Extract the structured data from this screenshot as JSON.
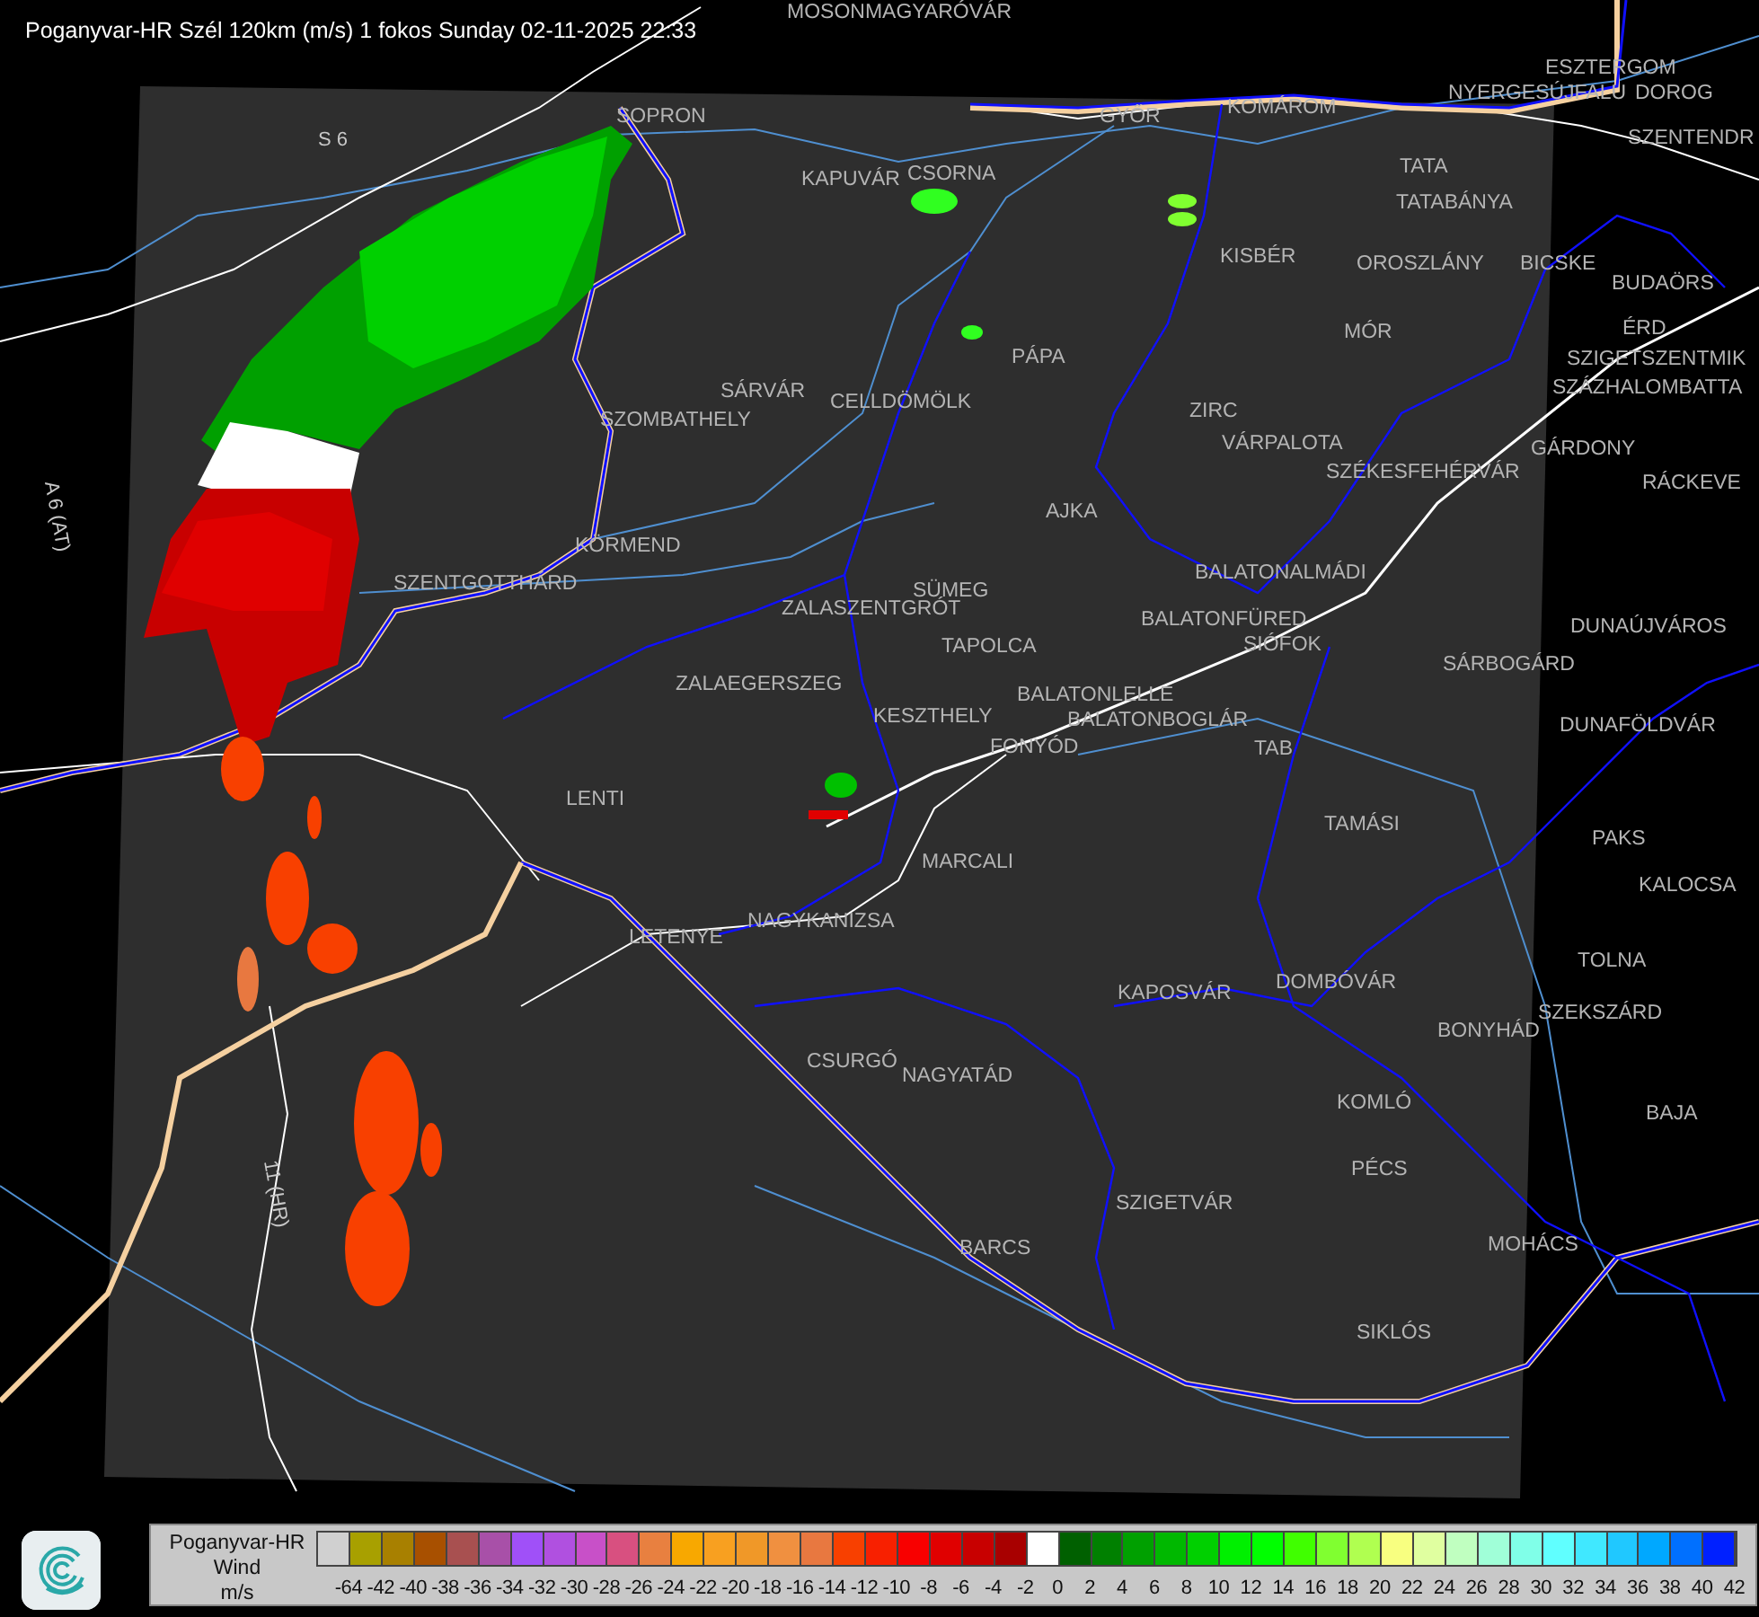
{
  "title": "Poganyvar-HR Szél 120km (m/s) 1 fokos Sunday 02-11-2025 22:33",
  "map": {
    "places": [
      {
        "name": "MOSONMAGYARÓVÁR"
      },
      {
        "name": "ESZTERGOM"
      },
      {
        "name": "NYERGESÚJFALU"
      },
      {
        "name": "DOROG"
      },
      {
        "name": "KOMÁROM"
      },
      {
        "name": "SOPRON"
      },
      {
        "name": "GYŐR"
      },
      {
        "name": "SZENTENDR"
      },
      {
        "name": "TATA"
      },
      {
        "name": "KAPUVÁR"
      },
      {
        "name": "CSORNA"
      },
      {
        "name": "TATABÁNYA"
      },
      {
        "name": "KISBÉR"
      },
      {
        "name": "OROSZLÁNY"
      },
      {
        "name": "BICSKE"
      },
      {
        "name": "BUDAÖRS"
      },
      {
        "name": "MÓR"
      },
      {
        "name": "ÉRD"
      },
      {
        "name": "PÁPA"
      },
      {
        "name": "SZIGETSZENTMIK"
      },
      {
        "name": "SÁRVÁR"
      },
      {
        "name": "CELLDÖMÖLK"
      },
      {
        "name": "ZIRC"
      },
      {
        "name": "SZÁZHALOMBATTA"
      },
      {
        "name": "SZOMBATHELY"
      },
      {
        "name": "VÁRPALOTA"
      },
      {
        "name": "GÁRDONY"
      },
      {
        "name": "SZÉKESFEHÉRVÁR"
      },
      {
        "name": "RÁCKEVE"
      },
      {
        "name": "AJKA"
      },
      {
        "name": "KÖRMEND"
      },
      {
        "name": "BALATONALMÁDI"
      },
      {
        "name": "SZENTGOTTHÁRD"
      },
      {
        "name": "SÜMEG"
      },
      {
        "name": "ZALASZENTGRÓT"
      },
      {
        "name": "BALATONFÜRED"
      },
      {
        "name": "DUNAÚJVÁROS"
      },
      {
        "name": "SIÓFOK"
      },
      {
        "name": "TAPOLCA"
      },
      {
        "name": "SÁRBOGÁRD"
      },
      {
        "name": "ZALAEGERSZEG"
      },
      {
        "name": "BALATONLELLE"
      },
      {
        "name": "KESZTHELY"
      },
      {
        "name": "BALATONBOGLÁR"
      },
      {
        "name": "DUNAFÖLDVÁR"
      },
      {
        "name": "FONYÓD"
      },
      {
        "name": "TAB"
      },
      {
        "name": "LENTI"
      },
      {
        "name": "TAMÁSI"
      },
      {
        "name": "PAKS"
      },
      {
        "name": "MARCALI"
      },
      {
        "name": "KALOCSA"
      },
      {
        "name": "NAGYKANIZSA"
      },
      {
        "name": "LETENYE"
      },
      {
        "name": "TOLNA"
      },
      {
        "name": "DOMBÓVÁR"
      },
      {
        "name": "KAPOSVÁR"
      },
      {
        "name": "SZEKSZÁRD"
      },
      {
        "name": "BONYHÁD"
      },
      {
        "name": "CSURGÓ"
      },
      {
        "name": "NAGYATÁD"
      },
      {
        "name": "KOMLÓ"
      },
      {
        "name": "BAJA"
      },
      {
        "name": "PÉCS"
      },
      {
        "name": "SZIGETVÁR"
      },
      {
        "name": "MOHÁCS"
      },
      {
        "name": "BARCS"
      },
      {
        "name": "SIKLÓS"
      }
    ],
    "roads": [
      {
        "name": "S 6"
      },
      {
        "name": "A 6 (AT)"
      },
      {
        "name": "11 (HR)"
      }
    ]
  },
  "legend": {
    "title": [
      "Poganyvar-HR",
      "Wind",
      "m/s"
    ],
    "items": [
      {
        "label": "-64",
        "color": "#d0d0d0"
      },
      {
        "label": "-42",
        "color": "#a8a000"
      },
      {
        "label": "-40",
        "color": "#a88000"
      },
      {
        "label": "-38",
        "color": "#a85000"
      },
      {
        "label": "-36",
        "color": "#a85050"
      },
      {
        "label": "-34",
        "color": "#a850a8"
      },
      {
        "label": "-32",
        "color": "#a050f8"
      },
      {
        "label": "-30",
        "color": "#b050e0"
      },
      {
        "label": "-28",
        "color": "#c850c8"
      },
      {
        "label": "-26",
        "color": "#d85080"
      },
      {
        "label": "-24",
        "color": "#e88040"
      },
      {
        "label": "-22",
        "color": "#f8a800"
      },
      {
        "label": "-20",
        "color": "#f8a020"
      },
      {
        "label": "-18",
        "color": "#f09828"
      },
      {
        "label": "-16",
        "color": "#f09040"
      },
      {
        "label": "-14",
        "color": "#e87840"
      },
      {
        "label": "-12",
        "color": "#f84000"
      },
      {
        "label": "-10",
        "color": "#f82000"
      },
      {
        "label": "-8",
        "color": "#f80000"
      },
      {
        "label": "-6",
        "color": "#e00000"
      },
      {
        "label": "-4",
        "color": "#c80000"
      },
      {
        "label": "-2",
        "color": "#a80000"
      },
      {
        "label": "0",
        "color": "#ffffff"
      },
      {
        "label": "2",
        "color": "#006000"
      },
      {
        "label": "4",
        "color": "#008000"
      },
      {
        "label": "6",
        "color": "#00a000"
      },
      {
        "label": "8",
        "color": "#00b800"
      },
      {
        "label": "10",
        "color": "#00d000"
      },
      {
        "label": "12",
        "color": "#00f000"
      },
      {
        "label": "14",
        "color": "#00ff00"
      },
      {
        "label": "16",
        "color": "#40ff00"
      },
      {
        "label": "18",
        "color": "#80ff30"
      },
      {
        "label": "20",
        "color": "#b0ff50"
      },
      {
        "label": "22",
        "color": "#f8ff80"
      },
      {
        "label": "24",
        "color": "#e0ffa0"
      },
      {
        "label": "26",
        "color": "#c0ffc0"
      },
      {
        "label": "28",
        "color": "#a0ffd8"
      },
      {
        "label": "30",
        "color": "#80ffe8"
      },
      {
        "label": "32",
        "color": "#60ffff"
      },
      {
        "label": "34",
        "color": "#40e8ff"
      },
      {
        "label": "36",
        "color": "#20c8ff"
      },
      {
        "label": "38",
        "color": "#00a8ff"
      },
      {
        "label": "40",
        "color": "#0070ff"
      },
      {
        "label": "42",
        "color": "#0020ff"
      }
    ]
  }
}
